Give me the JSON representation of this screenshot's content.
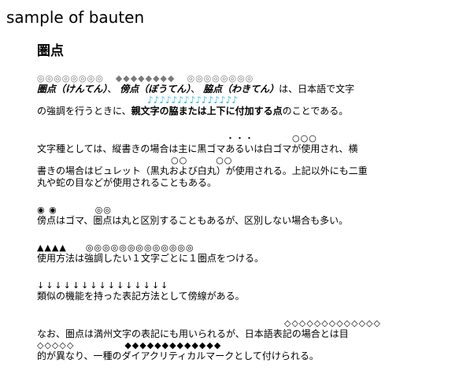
{
  "page": {
    "title": "sample of bauten"
  },
  "article": {
    "heading": "圏点",
    "p1": {
      "marks": [
        "◎◎◎◎◎◎◎◎",
        "◆◆◆◆◆◆◆◆",
        "◎◎◎◎◎◎◎◎"
      ],
      "terms": [
        "圏点（けんてん）",
        "傍点（ぼうてん）",
        "脇点（わきてん）"
      ],
      "sep1": "、",
      "sep2": "、",
      "after_terms": "は、日本語で文字",
      "notes": "♪♪♪♪♪♪♪♪♪♪♪♪♪♪♪",
      "line2_start": "の強調を行うときに、",
      "line2_bold": "親文字の脇または上下に付加する点",
      "line2_end": "のことである。"
    },
    "p2": {
      "marks_top": "・・・　　　　○○○",
      "line1": "文字種としては、縦書きの場合は主に黒ゴマあるいは白ゴマが使用され、横",
      "marks_mid": "○○　　　○○",
      "line2": "書きの場合はビュレット（黒丸および白丸）が使用される。上記以外にも二重",
      "line3": "丸や蛇の目などが使用されることもある。"
    },
    "p3": {
      "marks": "◉ ◉　　　　◎◎",
      "line1": "傍点はゴマ、圏点は丸と区別することもあるが、区別しない場合も多い。"
    },
    "p4": {
      "marks": "▲▲▲▲　　◎◎◎◎◎◎◎◎◎◎◎◎◎",
      "line1": "使用方法は強調したい１文字ごとに１圏点をつける。"
    },
    "p5": {
      "marks": "↓↓↓↓↓↓↓↓↓↓↓↓↓↓↓",
      "line1": "類似の機能を持った表記方法として傍線がある。"
    },
    "p6": {
      "marks_top": "◇◇◇◇◇◇◇◇◇◇◇◇◇",
      "line1": "なお、圏点は満州文字の表記にも用いられるが、日本語表記の場合とは目",
      "marks_mid_left": "◇◇◇◇◇",
      "marks_mid_right": "◆◆◆◆◆◆◆◆◆◆◆◆◆",
      "line2": "的が異なり、一種のダイアクリティカルマークとして付けられる。"
    }
  }
}
